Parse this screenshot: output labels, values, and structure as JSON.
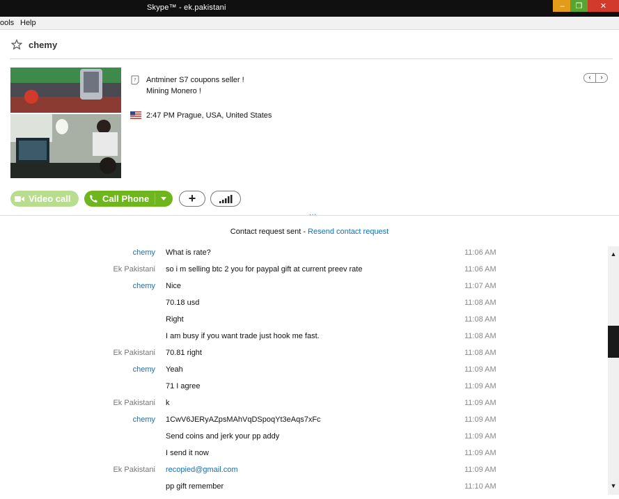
{
  "window": {
    "title": "Skype™ - ek.pakistani",
    "minimize": "–",
    "maximize": "❐",
    "close": "✕"
  },
  "menu": {
    "items": [
      "ools",
      "Help"
    ]
  },
  "contact": {
    "name": "chemy",
    "mood_line1": "Antminer S7 coupons seller !",
    "mood_line2": "Mining Monero !",
    "location": "2:47 PM Prague, USA, United States",
    "nav_prev": "‹",
    "nav_next": "›"
  },
  "buttons": {
    "video_call": "Video call",
    "call_phone": "Call Phone",
    "add": "+",
    "more_dots": "..."
  },
  "notice": {
    "text": "Contact request sent - ",
    "link": "Resend contact request"
  },
  "messages": [
    {
      "sender": "chemy",
      "text": "What is rate?",
      "time": "11:06 AM"
    },
    {
      "sender": "Ek Pakistani",
      "text": "so i m selling btc 2 you for paypal gift at current preev rate",
      "time": "11:06 AM"
    },
    {
      "sender": "chemy",
      "text": "Nice",
      "time": "11:07 AM"
    },
    {
      "sender": "",
      "text": "70.18 usd",
      "time": "11:08 AM"
    },
    {
      "sender": "",
      "text": "Right",
      "time": "11:08 AM"
    },
    {
      "sender": "",
      "text": "I am busy if you want trade just hook me fast.",
      "time": "11:08 AM"
    },
    {
      "sender": "Ek Pakistani",
      "text": "70.81 right",
      "time": "11:08 AM"
    },
    {
      "sender": "chemy",
      "text": "Yeah",
      "time": "11:09 AM"
    },
    {
      "sender": "",
      "text": "71 I agree",
      "time": "11:09 AM"
    },
    {
      "sender": "Ek Pakistani",
      "text": "k",
      "time": "11:09 AM"
    },
    {
      "sender": "chemy",
      "text": "1CwV6JERyAZpsMAhVqDSpoqYt3eAqs7xFc",
      "time": "11:09 AM"
    },
    {
      "sender": "",
      "text": "Send coins and jerk your pp addy",
      "time": "11:09 AM"
    },
    {
      "sender": "",
      "text": "I send it now",
      "time": "11:09 AM"
    },
    {
      "sender": "Ek Pakistani",
      "text": "recopied@gmail.com",
      "time": "11:09 AM"
    },
    {
      "sender": "",
      "text": "pp gift remember",
      "time": "11:10 AM"
    }
  ],
  "scrollbar": {
    "up": "▲",
    "down": "▼"
  },
  "colors": {
    "skype_link": "#1a6fb0",
    "call_green": "#6fb51d",
    "video_green_disabled": "#b8dd8f"
  }
}
